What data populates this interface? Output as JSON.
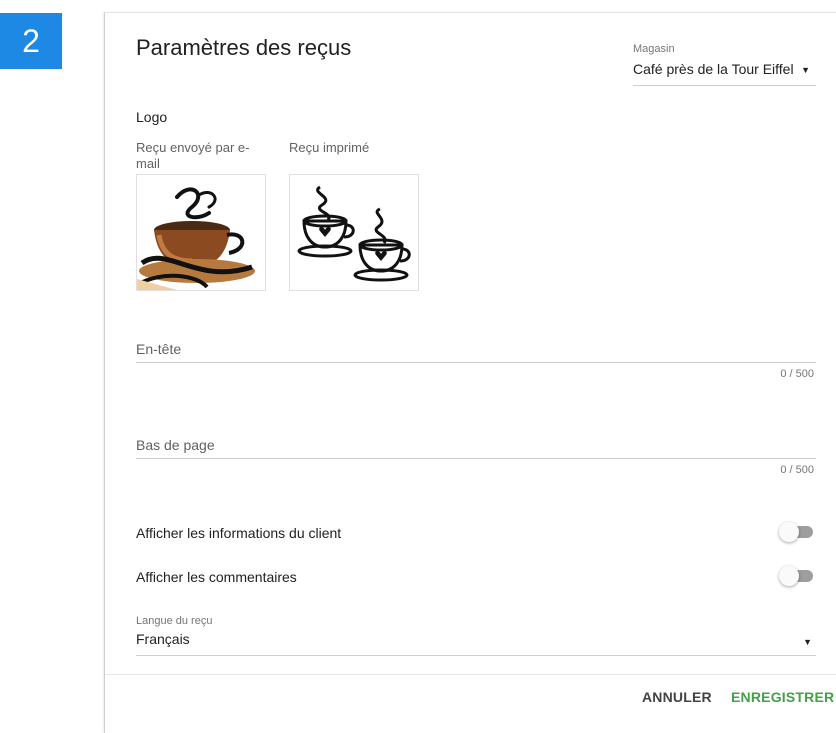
{
  "step": {
    "number": "2"
  },
  "page": {
    "title": "Paramètres des reçus"
  },
  "store": {
    "label": "Magasin",
    "value": "Café près de la Tour Eiffel"
  },
  "logo": {
    "heading": "Logo",
    "email_label": "Reçu envoyé par e-mail",
    "printed_label": "Reçu imprimé"
  },
  "header_field": {
    "label": "En-tête",
    "value": "",
    "counter": "0 / 500"
  },
  "footer_field": {
    "label": "Bas de page",
    "value": "",
    "counter": "0 / 500"
  },
  "toggles": {
    "customer_info": {
      "label": "Afficher les informations du client",
      "on": false
    },
    "comments": {
      "label": "Afficher les commentaires",
      "on": false
    }
  },
  "language": {
    "label": "Langue du reçu",
    "value": "Français"
  },
  "actions": {
    "cancel": "ANNULER",
    "save": "ENREGISTRER"
  },
  "colors": {
    "accent": "#43a047",
    "badge": "#1e88e5"
  }
}
